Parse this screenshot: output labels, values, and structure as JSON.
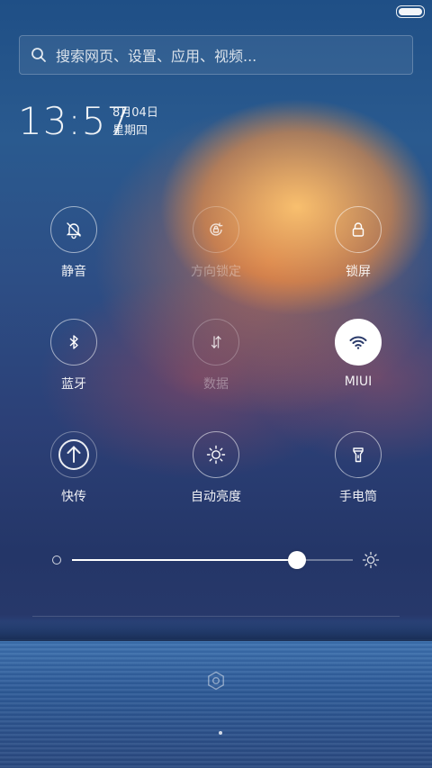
{
  "status": {
    "battery_level": 1.0
  },
  "search": {
    "placeholder": "搜索网页、设置、应用、视频..."
  },
  "clock": {
    "time": "13:57",
    "date": "8月04日",
    "weekday": "星期四"
  },
  "toggles": [
    {
      "label": "静音",
      "icon": "bell-off-icon",
      "state": "off"
    },
    {
      "label": "方向锁定",
      "icon": "rotation-lock-icon",
      "state": "disabled"
    },
    {
      "label": "锁屏",
      "icon": "lock-icon",
      "state": "off"
    },
    {
      "label": "蓝牙",
      "icon": "bluetooth-icon",
      "state": "off"
    },
    {
      "label": "数据",
      "icon": "mobile-data-icon",
      "state": "disabled"
    },
    {
      "label": "MIUI",
      "icon": "wifi-icon",
      "state": "on"
    },
    {
      "label": "快传",
      "icon": "upload-arrow-icon",
      "state": "off"
    },
    {
      "label": "自动亮度",
      "icon": "sun-icon",
      "state": "off"
    },
    {
      "label": "手电筒",
      "icon": "flashlight-icon",
      "state": "off"
    }
  ],
  "brightness": {
    "value_fraction": 0.8
  },
  "pager": {
    "current_page": 1,
    "total_pages": 1
  }
}
